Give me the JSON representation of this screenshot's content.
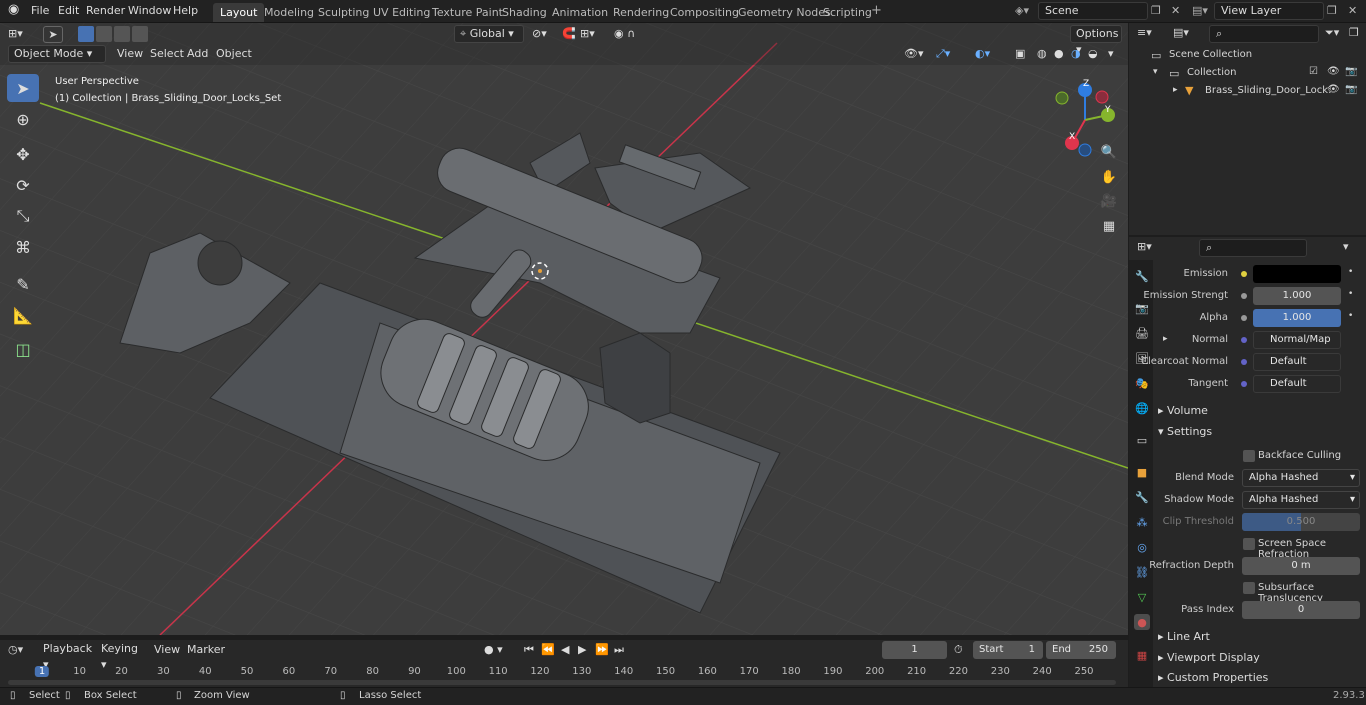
{
  "menu": {
    "file": "File",
    "edit": "Edit",
    "render": "Render",
    "window": "Window",
    "help": "Help"
  },
  "workspaces": [
    "Layout",
    "Modeling",
    "Sculpting",
    "UV Editing",
    "Texture Paint",
    "Shading",
    "Animation",
    "Rendering",
    "Compositing",
    "Geometry Nodes",
    "Scripting"
  ],
  "scene": {
    "label": "Scene",
    "view_layer": "View Layer"
  },
  "viewport_header": {
    "mode": "Object Mode",
    "view": "View",
    "select": "Select",
    "add": "Add",
    "object": "Object",
    "orientation": "Global",
    "options": "Options"
  },
  "overlay": {
    "perspective": "User Perspective",
    "collection_path": "(1) Collection | Brass_Sliding_Door_Locks_Set"
  },
  "gizmo": {
    "x": "X",
    "y": "Y",
    "z": "Z"
  },
  "outliner": {
    "scene_collection": "Scene Collection",
    "collection": "Collection",
    "object": "Brass_Sliding_Door_Lock:"
  },
  "properties": {
    "rows": [
      {
        "label": "Emission",
        "value": ""
      },
      {
        "label": "Emission Strengt",
        "value": "1.000"
      },
      {
        "label": "Alpha",
        "value": "1.000"
      },
      {
        "label": "Normal",
        "value": "Normal/Map"
      },
      {
        "label": "Clearcoat Normal",
        "value": "Default"
      },
      {
        "label": "Tangent",
        "value": "Default"
      }
    ],
    "volume": "Volume",
    "settings": "Settings",
    "backface": "Backface Culling",
    "blend_mode_label": "Blend Mode",
    "blend_mode": "Alpha Hashed",
    "shadow_mode_label": "Shadow Mode",
    "shadow_mode": "Alpha Hashed",
    "clip_label": "Clip Threshold",
    "clip_value": "0.500",
    "ssr": "Screen Space Refraction",
    "refr_label": "Refraction Depth",
    "refr_value": "0 m",
    "subsurface": "Subsurface Translucency",
    "pass_label": "Pass Index",
    "pass_value": "0",
    "line_art": "Line Art",
    "viewport_display": "Viewport Display",
    "custom_props": "Custom Properties"
  },
  "timeline": {
    "playback": "Playback",
    "keying": "Keying",
    "view": "View",
    "marker": "Marker",
    "current_frame": "1",
    "start_label": "Start",
    "start": "1",
    "end_label": "End",
    "end": "250",
    "ticks": [
      "1",
      "10",
      "20",
      "30",
      "40",
      "50",
      "60",
      "70",
      "80",
      "90",
      "100",
      "110",
      "120",
      "130",
      "140",
      "150",
      "160",
      "170",
      "180",
      "190",
      "200",
      "210",
      "220",
      "230",
      "240",
      "250"
    ]
  },
  "status": {
    "select": "Select",
    "box_select": "Box Select",
    "zoom": "Zoom View",
    "lasso": "Lasso Select",
    "version": "2.93.3"
  },
  "colors": {
    "accent": "#4772b3",
    "x_axis": "#e0354d",
    "y_axis": "#86b52d",
    "z_axis": "#2f7de1"
  }
}
